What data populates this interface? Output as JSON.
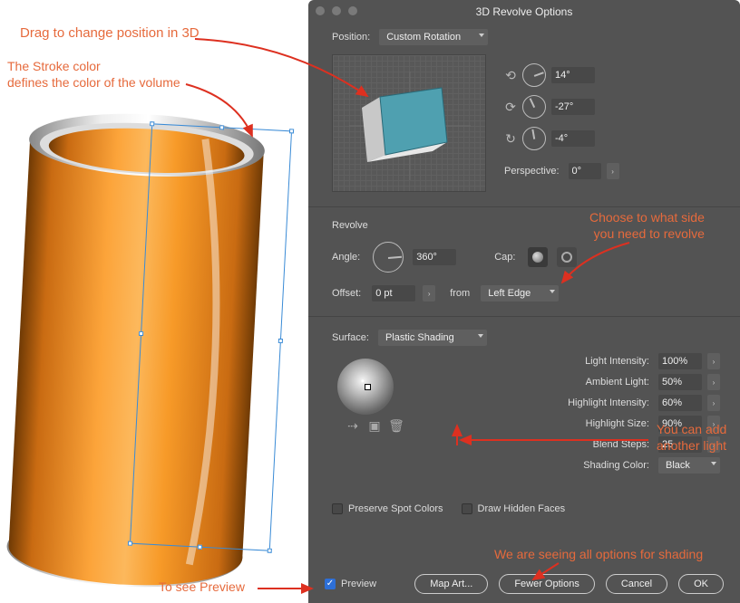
{
  "dialog": {
    "title": "3D Revolve Options",
    "position_label": "Position:",
    "position_value": "Custom Rotation",
    "rotate_x": "14°",
    "rotate_y": "-27°",
    "rotate_z": "-4°",
    "perspective_label": "Perspective:",
    "perspective_value": "0°",
    "revolve_heading": "Revolve",
    "angle_label": "Angle:",
    "angle_value": "360°",
    "cap_label": "Cap:",
    "offset_label": "Offset:",
    "offset_value": "0 pt",
    "from_label": "from",
    "from_value": "Left Edge",
    "surface_label": "Surface:",
    "surface_value": "Plastic Shading",
    "light_intensity_label": "Light Intensity:",
    "light_intensity_value": "100%",
    "ambient_light_label": "Ambient Light:",
    "ambient_light_value": "50%",
    "highlight_intensity_label": "Highlight Intensity:",
    "highlight_intensity_value": "60%",
    "highlight_size_label": "Highlight Size:",
    "highlight_size_value": "90%",
    "blend_steps_label": "Blend Steps:",
    "blend_steps_value": "25",
    "shading_color_label": "Shading Color:",
    "shading_color_value": "Black",
    "preserve_spot_label": "Preserve Spot Colors",
    "draw_hidden_label": "Draw Hidden Faces",
    "preview_label": "Preview",
    "map_art_label": "Map Art...",
    "fewer_options_label": "Fewer Options",
    "cancel_label": "Cancel",
    "ok_label": "OK"
  },
  "annotations": {
    "drag_3d": "Drag to change position in 3D",
    "stroke_color": "The Stroke color\ndefines the color of the volume",
    "side_revolve": "Choose to what side\nyou need to revolve",
    "add_light": "You can add\nanother light",
    "all_options": "We are seeing all options for shading",
    "to_preview": "To see Preview"
  }
}
